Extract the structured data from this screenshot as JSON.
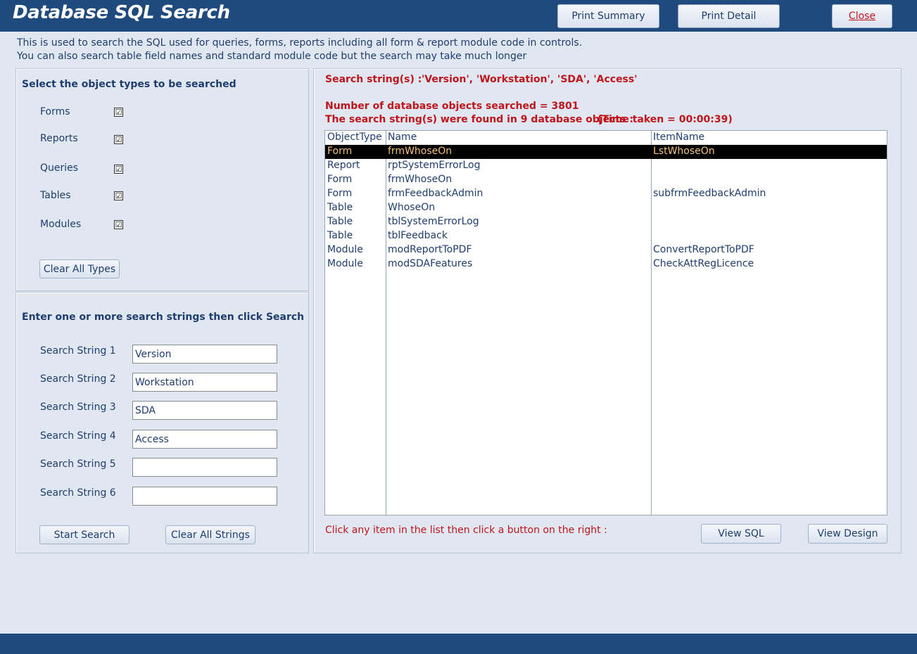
{
  "header": {
    "title": "Database SQL Search",
    "print_summary_label": "Print Summary",
    "print_detail_label": "Print Detail",
    "close_label": "Close"
  },
  "description": {
    "line1": "This is used to search the SQL used for queries, forms, reports including all form & report module code in controls.",
    "line2": "You can also search table field names and standard module code but the search may take much longer"
  },
  "object_types": {
    "heading": "Select the object types to be searched",
    "items": [
      {
        "label": "Forms",
        "checked": true,
        "mark": "☑"
      },
      {
        "label": "Reports",
        "checked": true,
        "mark": "☑"
      },
      {
        "label": "Queries",
        "checked": true,
        "mark": "☑"
      },
      {
        "label": "Tables",
        "checked": true,
        "mark": "☑"
      },
      {
        "label": "Modules",
        "checked": true,
        "mark": "☑"
      }
    ],
    "clear_button_label": "Clear All Types"
  },
  "search_strings": {
    "heading": "Enter one or more search strings then click Search",
    "fields": [
      {
        "label": "Search String 1",
        "value": "Version"
      },
      {
        "label": "Search String 2",
        "value": "Workstation"
      },
      {
        "label": "Search String 3",
        "value": "SDA"
      },
      {
        "label": "Search String 4",
        "value": "Access"
      },
      {
        "label": "Search String 5",
        "value": ""
      },
      {
        "label": "Search String 6",
        "value": ""
      }
    ],
    "start_button_label": "Start Search",
    "clear_button_label": "Clear All Strings"
  },
  "results": {
    "search_label": "Search string(s) :",
    "search_value": "'Version', 'Workstation', 'SDA', 'Access'",
    "objects_searched": "Number of database objects searched = 3801",
    "found_text": "The search string(s) were found in 9 database objects :",
    "time_taken": "(Time taken = 00:00:39)",
    "columns": [
      "ObjectType",
      "Name",
      "ItemName"
    ],
    "rows": [
      {
        "type": "Form",
        "name": "frmWhoseOn",
        "item": "LstWhoseOn",
        "selected": true
      },
      {
        "type": "Report",
        "name": "rptSystemErrorLog",
        "item": ""
      },
      {
        "type": "Form",
        "name": "frmWhoseOn",
        "item": ""
      },
      {
        "type": "Form",
        "name": "frmFeedbackAdmin",
        "item": "subfrmFeedbackAdmin"
      },
      {
        "type": "Table",
        "name": "WhoseOn",
        "item": ""
      },
      {
        "type": "Table",
        "name": "tblSystemErrorLog",
        "item": ""
      },
      {
        "type": "Table",
        "name": "tblFeedback",
        "item": ""
      },
      {
        "type": "Module",
        "name": "modReportToPDF",
        "item": "ConvertReportToPDF"
      },
      {
        "type": "Module",
        "name": "modSDAFeatures",
        "item": "CheckAttRegLicence"
      }
    ],
    "hint": "Click any item in the list then click a button on the right :",
    "view_sql_label": "View SQL",
    "view_design_label": "View Design"
  }
}
